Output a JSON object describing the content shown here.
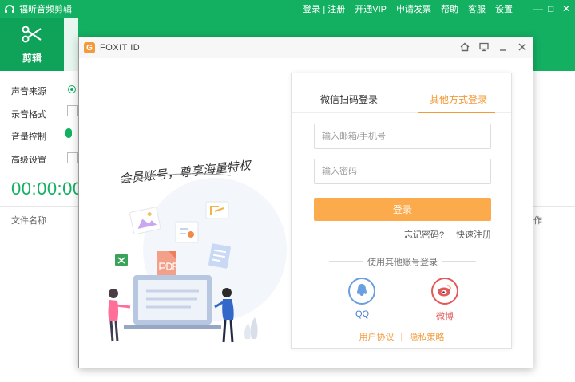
{
  "app": {
    "title": "福昕音频剪辑",
    "menu": [
      "登录 | 注册",
      "开通VIP",
      "申请发票",
      "帮助",
      "客服",
      "设置"
    ],
    "active_tool_label": "剪辑",
    "settings": {
      "audio_source": "声音来源",
      "record_format": "录音格式",
      "volume_control": "音量控制",
      "advanced": "高级设置"
    },
    "timer": "00:00:00",
    "list_header_name": "文件名称",
    "list_header_right": "作",
    "brand_color": "#13b062"
  },
  "dialog": {
    "title": "FOXIT ID",
    "logo_letter": "G",
    "slogan": "会员账号，尊享海量特权",
    "tabs": [
      "微信扫码登录",
      "其他方式登录"
    ],
    "active_tab": 1,
    "email_placeholder": "输入邮箱/手机号",
    "password_placeholder": "输入密码",
    "login_label": "登录",
    "forgot_label": "忘记密码?",
    "register_label": "快速注册",
    "other_accounts_label": "使用其他账号登录",
    "qq_label": "QQ",
    "weibo_label": "微博",
    "user_agreement": "用户协议",
    "privacy_policy": "隐私策略",
    "accent_color": "#fbaa4c"
  }
}
